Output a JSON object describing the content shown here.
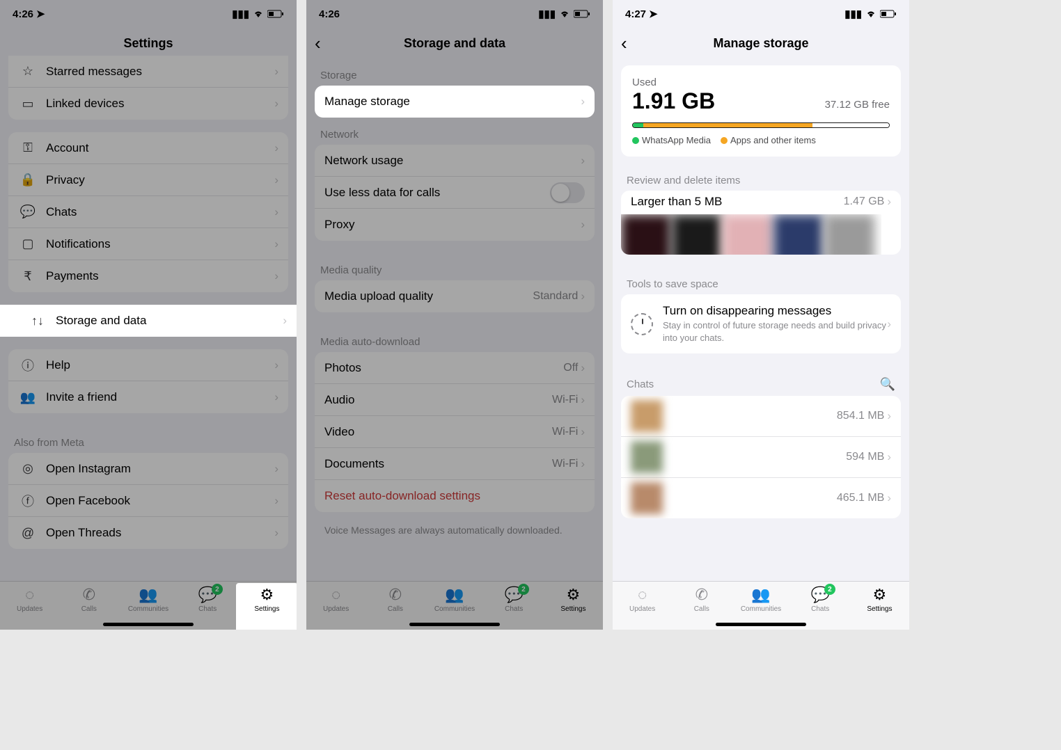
{
  "status": {
    "time1": "4:26",
    "time2": "4:26",
    "time3": "4:27"
  },
  "screen1": {
    "title": "Settings",
    "rows": {
      "starred": "Starred messages",
      "linked": "Linked devices",
      "account": "Account",
      "privacy": "Privacy",
      "chats": "Chats",
      "notifications": "Notifications",
      "payments": "Payments",
      "storage": "Storage and data",
      "help": "Help",
      "invite": "Invite a friend"
    },
    "meta_head": "Also from Meta",
    "meta": {
      "instagram": "Open Instagram",
      "facebook": "Open Facebook",
      "threads": "Open Threads"
    }
  },
  "screen2": {
    "title": "Storage and data",
    "sections": {
      "storage": "Storage",
      "network": "Network",
      "media_quality": "Media quality",
      "media_auto": "Media auto-download"
    },
    "rows": {
      "manage": "Manage storage",
      "network_usage": "Network usage",
      "less_data": "Use less data for calls",
      "proxy": "Proxy",
      "upload_quality": "Media upload quality",
      "upload_quality_val": "Standard",
      "photos": "Photos",
      "photos_val": "Off",
      "audio": "Audio",
      "audio_val": "Wi-Fi",
      "video": "Video",
      "video_val": "Wi-Fi",
      "documents": "Documents",
      "documents_val": "Wi-Fi",
      "reset": "Reset auto-download settings"
    },
    "footnote": "Voice Messages are always automatically downloaded."
  },
  "screen3": {
    "title": "Manage storage",
    "used_label": "Used",
    "used": "1.91 GB",
    "free": "37.12 GB free",
    "legend": {
      "a": "WhatsApp Media",
      "b": "Apps and other items"
    },
    "review_head": "Review and delete items",
    "larger": {
      "label": "Larger than 5 MB",
      "size": "1.47 GB"
    },
    "tools_head": "Tools to save space",
    "disappearing": {
      "title": "Turn on disappearing messages",
      "sub": "Stay in control of future storage needs and build privacy into your chats."
    },
    "chats_head": "Chats",
    "chat_sizes": [
      "854.1 MB",
      "594 MB",
      "465.1 MB"
    ]
  },
  "tabs": {
    "updates": "Updates",
    "calls": "Calls",
    "communities": "Communities",
    "chats": "Chats",
    "settings": "Settings",
    "badge": "2"
  },
  "colors": {
    "green": "#22c55e",
    "orange": "#f5a623"
  },
  "chart_data": {
    "type": "bar",
    "title": "Storage usage",
    "total_gb": 39.03,
    "segments": [
      {
        "name": "WhatsApp Media",
        "gb": 1.91,
        "color": "#22c55e"
      },
      {
        "name": "Apps and other items",
        "gb": 25.5,
        "color": "#f5a623"
      },
      {
        "name": "Free",
        "gb": 37.12,
        "color": "#ffffff"
      }
    ]
  }
}
